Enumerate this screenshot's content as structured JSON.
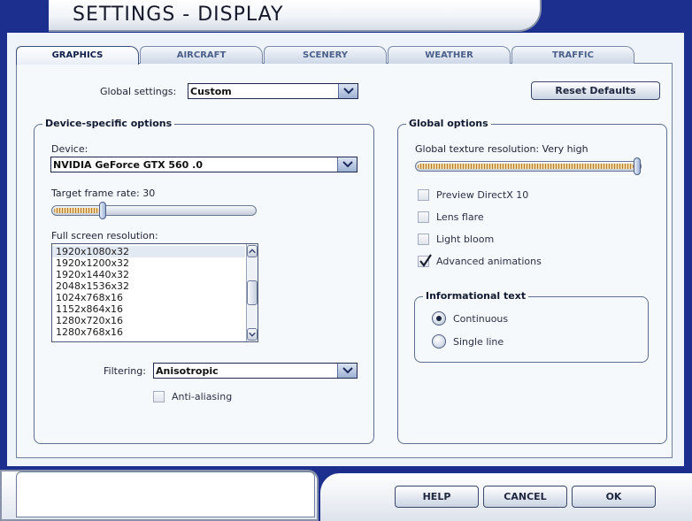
{
  "window": {
    "title": "SETTINGS - DISPLAY"
  },
  "tabs": [
    {
      "label": "GRAPHICS",
      "active": true
    },
    {
      "label": "AIRCRAFT",
      "active": false
    },
    {
      "label": "SCENERY",
      "active": false
    },
    {
      "label": "WEATHER",
      "active": false
    },
    {
      "label": "TRAFFIC",
      "active": false
    }
  ],
  "global_settings": {
    "label": "Global settings:",
    "value": "Custom"
  },
  "reset_defaults": {
    "label": "Reset Defaults"
  },
  "device_group": {
    "title": "Device-specific options",
    "device_label": "Device:",
    "device_value": "NVIDIA GeForce GTX 560 .0",
    "frame_rate_label": "Target frame rate: 30",
    "frame_rate_fraction": 0.23,
    "resolution_label": "Full screen resolution:",
    "resolutions": [
      "1920x1080x32",
      "1920x1200x32",
      "1920x1440x32",
      "2048x1536x32",
      "1024x768x16",
      "1152x864x16",
      "1280x720x16",
      "1280x768x16"
    ],
    "selected_resolution": "1920x1080x32",
    "filtering_label": "Filtering:",
    "filtering_value": "Anisotropic",
    "anti_aliasing_label": "Anti-aliasing",
    "anti_aliasing_checked": false
  },
  "global_group": {
    "title": "Global options",
    "texture_label": "Global texture resolution: Very high",
    "texture_fraction": 1.0,
    "options": [
      {
        "label": "Preview DirectX 10",
        "checked": false
      },
      {
        "label": "Lens flare",
        "checked": false
      },
      {
        "label": "Light bloom",
        "checked": false
      },
      {
        "label": "Advanced animations",
        "checked": true
      }
    ],
    "info_text": {
      "title": "Informational text",
      "options": [
        {
          "label": "Continuous",
          "selected": true
        },
        {
          "label": "Single line",
          "selected": false
        }
      ]
    }
  },
  "footer": {
    "help_label": "HELP",
    "cancel_label": "CANCEL",
    "ok_label": "OK"
  },
  "colors": {
    "frame_blue": "#1c2e8e",
    "slider_fill": "#b87a2e"
  }
}
